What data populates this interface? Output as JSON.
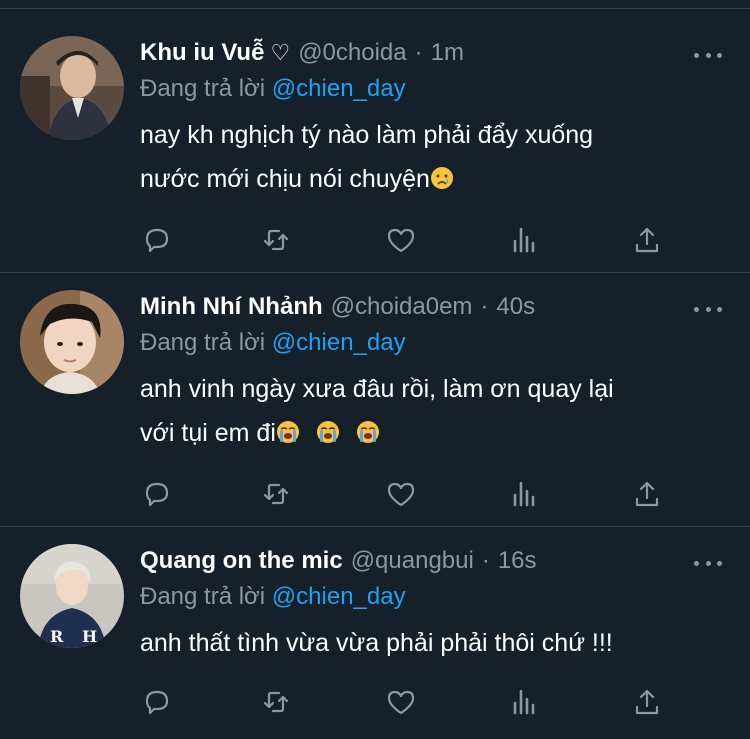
{
  "tweets": [
    {
      "name": "Khu iu Vuễ",
      "name_suffix": "♡",
      "handle": "@0choida",
      "separator": "·",
      "time": "1m",
      "reply_prefix": "Đang trả lời",
      "reply_mention": "@chien_day",
      "text_line1": "nay kh nghịch tý nào làm phải đẩy xuống",
      "text_line2": "nước mới chịu nói chuyện",
      "emojis": [
        "crying-face"
      ]
    },
    {
      "name": "Minh Nhí Nhảnh",
      "handle": "@choida0em",
      "separator": "·",
      "time": "40s",
      "reply_prefix": "Đang trả lời",
      "reply_mention": "@chien_day",
      "text_line1": "anh vinh ngày xưa đâu rồi, làm ơn quay lại",
      "text_line2": "với tụi em đi",
      "emojis": [
        "loudly-crying-face",
        "loudly-crying-face",
        "loudly-crying-face"
      ]
    },
    {
      "name": "Quang on the mic",
      "handle": "@quangbui",
      "separator": "·",
      "time": "16s",
      "reply_prefix": "Đang trả lời",
      "reply_mention": "@chien_day",
      "text_line1": "anh thất tình vừa vừa phải phải thôi chứ !!!"
    }
  ],
  "action_icons": [
    "reply-icon",
    "retweet-icon",
    "like-icon",
    "analytics-icon",
    "share-icon"
  ],
  "colors": {
    "background": "#15202b",
    "divider": "#38444d",
    "text_primary": "#ffffff",
    "text_secondary": "#8899a6",
    "link": "#1da1f2"
  }
}
